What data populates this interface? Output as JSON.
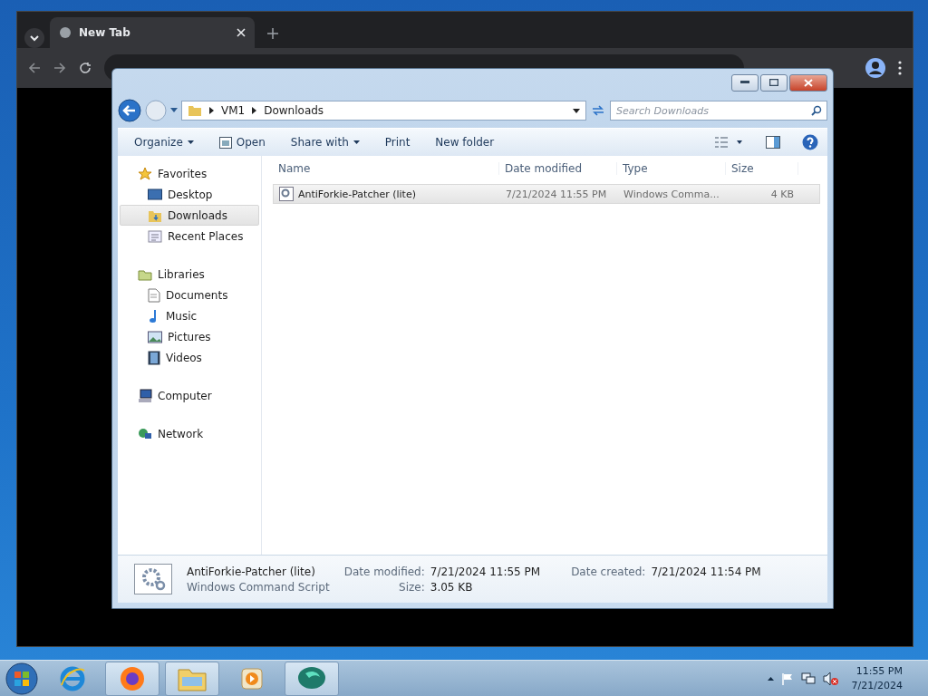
{
  "browser": {
    "tabs": [
      {
        "label": "New Tab",
        "selected": true
      }
    ]
  },
  "explorer": {
    "breadcrumb": [
      "VM1",
      "Downloads"
    ],
    "search": {
      "placeholder": "Search Downloads"
    },
    "toolbar": [
      {
        "label": "Organize",
        "dropdown": true,
        "kind": "menu"
      },
      {
        "label": "Open",
        "dropdown": false,
        "kind": "open"
      },
      {
        "label": "Share with",
        "dropdown": true,
        "kind": "menu"
      },
      {
        "label": "Print",
        "dropdown": false,
        "kind": "plain"
      },
      {
        "label": "New folder",
        "dropdown": false,
        "kind": "plain"
      }
    ],
    "sidebar": [
      {
        "label": "Favorites",
        "kind": "star",
        "selected": false,
        "children": [
          {
            "label": "Desktop",
            "kind": "desktop",
            "selected": false
          },
          {
            "label": "Downloads",
            "kind": "downloads",
            "selected": true
          },
          {
            "label": "Recent Places",
            "kind": "recent",
            "selected": false
          }
        ]
      },
      {
        "label": "Libraries",
        "kind": "library",
        "selected": false,
        "children": [
          {
            "label": "Documents",
            "kind": "document",
            "selected": false
          },
          {
            "label": "Music",
            "kind": "music",
            "selected": false
          },
          {
            "label": "Pictures",
            "kind": "pictures",
            "selected": false
          },
          {
            "label": "Videos",
            "kind": "videos",
            "selected": false
          }
        ]
      },
      {
        "label": "Computer",
        "kind": "computer",
        "selected": false
      },
      {
        "label": "Network",
        "kind": "network",
        "selected": false
      }
    ],
    "columns": [
      "Name",
      "Date modified",
      "Type",
      "Size"
    ],
    "rows": [
      {
        "name": "AntiForkie-Patcher (lite)",
        "date": "7/21/2024 11:55 PM",
        "type": "Windows Comma...",
        "size": "4 KB",
        "selected": true
      }
    ],
    "details": {
      "name": "AntiForkie-Patcher (lite)",
      "type": "Windows Command Script",
      "fields": [
        {
          "label": "Date modified:",
          "value": "7/21/2024 11:55 PM"
        },
        {
          "label": "Date created:",
          "value": "7/21/2024 11:54 PM"
        },
        {
          "label": "Size:",
          "value": "3.05 KB"
        }
      ]
    }
  },
  "taskbar": {
    "apps": [
      {
        "kind": "ie",
        "active": false
      },
      {
        "kind": "firefox",
        "active": true
      },
      {
        "kind": "folder",
        "active": true
      },
      {
        "kind": "media",
        "active": false
      },
      {
        "kind": "chat",
        "active": true
      }
    ],
    "time": "11:55 PM",
    "date": "7/21/2024"
  }
}
